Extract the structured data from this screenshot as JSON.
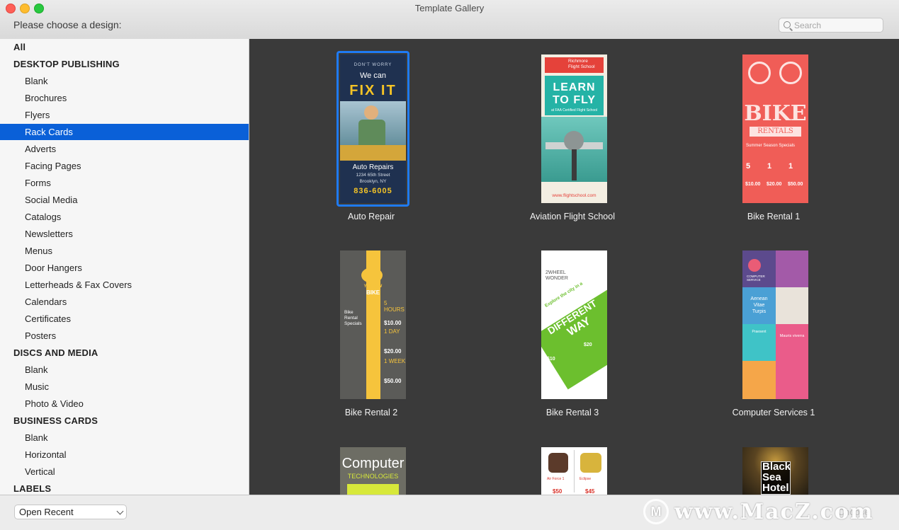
{
  "window": {
    "title": "Template Gallery",
    "prompt": "Please choose a design:"
  },
  "search": {
    "placeholder": "Search"
  },
  "sidebar": {
    "items": [
      {
        "label": "All",
        "type": "header"
      },
      {
        "label": "DESKTOP PUBLISHING",
        "type": "header"
      },
      {
        "label": "Blank",
        "type": "sub"
      },
      {
        "label": "Brochures",
        "type": "sub"
      },
      {
        "label": "Flyers",
        "type": "sub"
      },
      {
        "label": "Rack Cards",
        "type": "sub",
        "selected": true
      },
      {
        "label": "Adverts",
        "type": "sub"
      },
      {
        "label": "Facing Pages",
        "type": "sub"
      },
      {
        "label": "Forms",
        "type": "sub"
      },
      {
        "label": "Social Media",
        "type": "sub"
      },
      {
        "label": "Catalogs",
        "type": "sub"
      },
      {
        "label": "Newsletters",
        "type": "sub"
      },
      {
        "label": "Menus",
        "type": "sub"
      },
      {
        "label": "Door Hangers",
        "type": "sub"
      },
      {
        "label": "Letterheads & Fax Covers",
        "type": "sub"
      },
      {
        "label": "Calendars",
        "type": "sub"
      },
      {
        "label": "Certificates",
        "type": "sub"
      },
      {
        "label": "Posters",
        "type": "sub"
      },
      {
        "label": "DISCS AND MEDIA",
        "type": "header"
      },
      {
        "label": "Blank",
        "type": "sub"
      },
      {
        "label": "Music",
        "type": "sub"
      },
      {
        "label": "Photo & Video",
        "type": "sub"
      },
      {
        "label": "BUSINESS CARDS",
        "type": "header"
      },
      {
        "label": "Blank",
        "type": "sub"
      },
      {
        "label": "Horizontal",
        "type": "sub"
      },
      {
        "label": "Vertical",
        "type": "sub"
      },
      {
        "label": "LABELS",
        "type": "header"
      }
    ]
  },
  "gallery": {
    "templates": [
      {
        "name": "Auto Repair",
        "selected": true,
        "lines": [
          "DON'T WORRY",
          "We can",
          "FIX IT",
          "Auto Repairs",
          "1234 65th Street",
          "Brooklyn, NY",
          "836-6005"
        ]
      },
      {
        "name": "Aviation Flight School",
        "lines": [
          "Richmore",
          "Flight School",
          "LEARN",
          "TO FLY",
          "at FAA Certified Flight School",
          "www.flightschool.com"
        ]
      },
      {
        "name": "Bike Rental 1",
        "lines": [
          "BIKE",
          "RENTALS",
          "Summer Season Specials",
          "5",
          "1",
          "1",
          "$10.00",
          "$20.00",
          "$50.00"
        ]
      },
      {
        "name": "Bike Rental 2",
        "lines": [
          "YELLOW",
          "BIKE",
          "Bike",
          "Rental",
          "Specials",
          "5",
          "HOURS",
          "$10.00",
          "1",
          "DAY",
          "$20.00",
          "1",
          "WEEK",
          "$50.00"
        ]
      },
      {
        "name": "Bike Rental 3",
        "lines": [
          "2WHEEL",
          "WONDER",
          "Explore the city in a",
          "DIFFERENT",
          "WAY",
          "$10",
          "$20"
        ]
      },
      {
        "name": "Computer Services 1",
        "lines": [
          "COMPUTER",
          "SERVICE",
          "Aenean",
          "Vitae",
          "Turpis",
          "Praesent",
          "Mauris viverra"
        ]
      },
      {
        "name": "Computer Technologies",
        "lines": [
          "Computer",
          "TECHNOLOGIES"
        ]
      },
      {
        "name": "Shoes",
        "lines": [
          "Air Force 1",
          "Eclipse",
          "$50",
          "$45"
        ]
      },
      {
        "name": "Black Sea Hotel",
        "lines": [
          "Black",
          "Sea",
          "Hotel"
        ]
      }
    ]
  },
  "footer": {
    "open_recent": "Open Recent",
    "choose_button": "Choose",
    "watermark": "www.MacZ.com",
    "watermark_logo": "M"
  },
  "colors": {
    "selection": "#0a60d8",
    "gallery_bg": "#3a3a3a",
    "sidebar_bg": "#f6f6f6"
  }
}
